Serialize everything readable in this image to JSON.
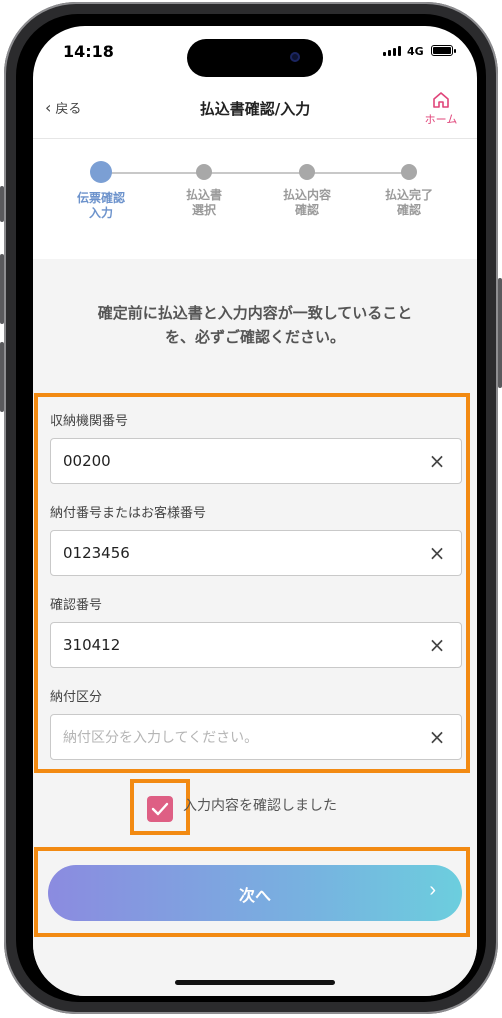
{
  "status_bar": {
    "time": "14:18",
    "network": "4G"
  },
  "nav": {
    "back_label": "戻る",
    "title": "払込書確認/入力",
    "home_label": "ホーム"
  },
  "steps": [
    {
      "label_line1": "伝票確認",
      "label_line2": "入力",
      "active": true
    },
    {
      "label_line1": "払込書",
      "label_line2": "選択",
      "active": false
    },
    {
      "label_line1": "払込内容",
      "label_line2": "確認",
      "active": false
    },
    {
      "label_line1": "払込完了",
      "label_line2": "確認",
      "active": false
    }
  ],
  "notice": {
    "line1": "確定前に払込書と入力内容が一致していること",
    "line2": "を、必ずご確認ください。"
  },
  "form": {
    "fields": [
      {
        "label": "収納機関番号",
        "value": "00200",
        "placeholder": ""
      },
      {
        "label": "納付番号またはお客様番号",
        "value": "0123456",
        "placeholder": ""
      },
      {
        "label": "確認番号",
        "value": "310412",
        "placeholder": ""
      },
      {
        "label": "納付区分",
        "value": "",
        "placeholder": "納付区分を入力してください。"
      }
    ],
    "clear_icon": "×"
  },
  "confirm_check": {
    "label": "入力内容を確認しました",
    "checked": true,
    "check_icon": "✓"
  },
  "next_button": {
    "label": "次へ",
    "arrow": "›"
  },
  "colors": {
    "accent_orange": "#f28a12",
    "brand_pink": "#e0457a",
    "checkbox_pink": "#de5f84",
    "step_active": "#7b9fd4"
  }
}
